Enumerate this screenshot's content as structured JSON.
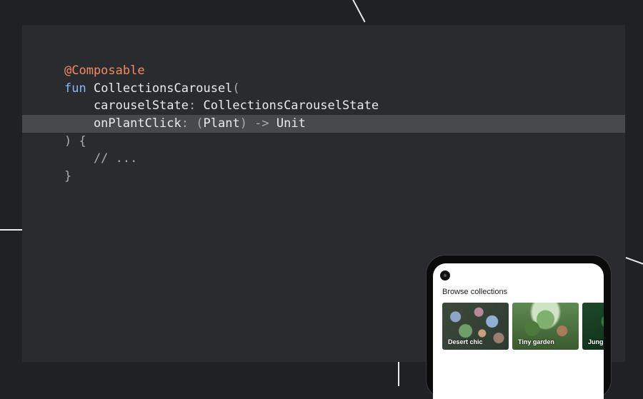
{
  "code": {
    "lines": [
      [
        {
          "t": "@Composable",
          "c": "annotation"
        }
      ],
      [
        {
          "t": "fun",
          "c": "keyword"
        },
        {
          "t": " CollectionsCarousel",
          "c": "plain"
        },
        {
          "t": "(",
          "c": "punct"
        }
      ],
      [
        {
          "t": "    carouselState",
          "c": "plain"
        },
        {
          "t": ":",
          "c": "punct"
        },
        {
          "t": " CollectionsCarouselState",
          "c": "plain"
        }
      ],
      [
        {
          "t": "    onPlantClick",
          "c": "plain"
        },
        {
          "t": ":",
          "c": "punct"
        },
        {
          "t": " (",
          "c": "punct"
        },
        {
          "t": "Plant",
          "c": "plain"
        },
        {
          "t": ")",
          "c": "punct"
        },
        {
          "t": " ->",
          "c": "punct"
        },
        {
          "t": " Unit",
          "c": "plain"
        }
      ],
      [
        {
          "t": ")",
          "c": "punct"
        },
        {
          "t": " {",
          "c": "punct"
        }
      ],
      [
        {
          "t": "    // ...",
          "c": "comment"
        }
      ],
      [
        {
          "t": "}",
          "c": "punct"
        }
      ]
    ],
    "highlighted_line": 3
  },
  "phone": {
    "screen_title": "Browse collections",
    "cards": [
      {
        "label": "Desert chic"
      },
      {
        "label": "Tiny garden"
      },
      {
        "label": "Jung"
      }
    ]
  }
}
